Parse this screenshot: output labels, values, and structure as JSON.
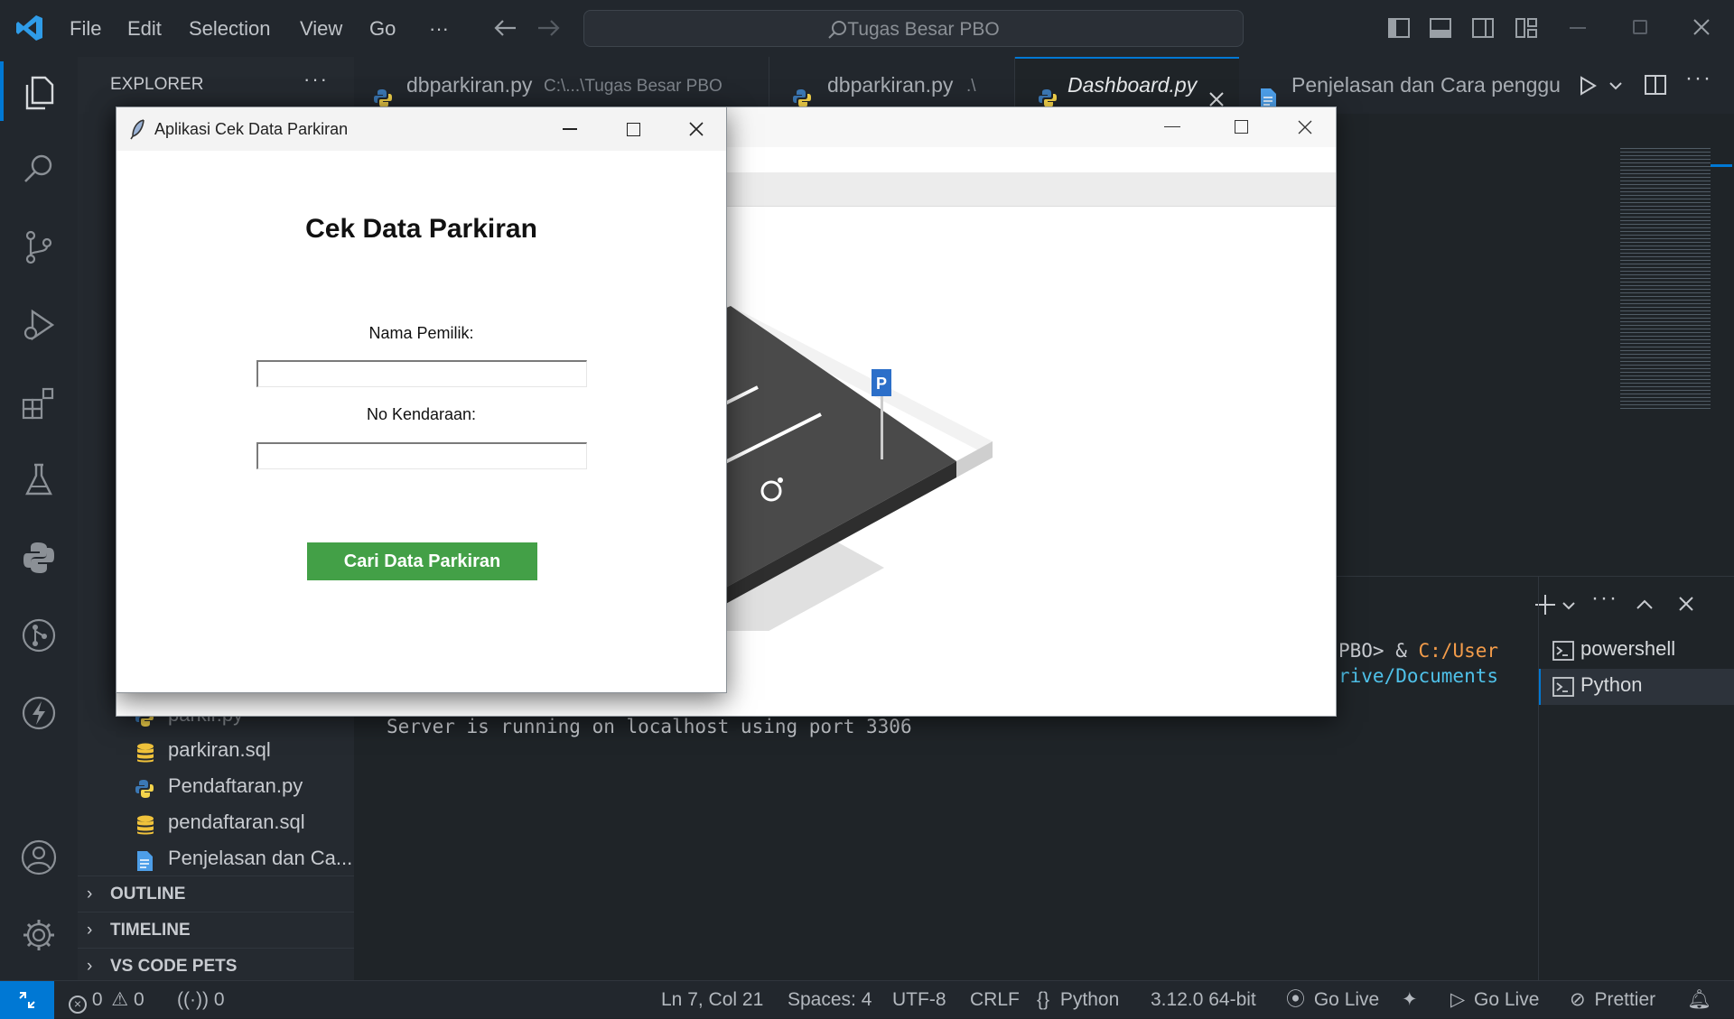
{
  "titlebar": {
    "menu": [
      "File",
      "Edit",
      "Selection",
      "View",
      "Go",
      "···"
    ],
    "search_label": "Tugas Besar PBO"
  },
  "sidebar": {
    "title": "EXPLORER",
    "files": [
      {
        "name": "parkir.py",
        "icon": "python-icon"
      },
      {
        "name": "parkiran.sql",
        "icon": "database-icon"
      },
      {
        "name": "Pendaftaran.py",
        "icon": "python-icon"
      },
      {
        "name": "pendaftaran.sql",
        "icon": "database-icon"
      },
      {
        "name": "Penjelasan dan Ca...",
        "icon": "document-icon"
      }
    ],
    "sections": [
      "OUTLINE",
      "TIMELINE",
      "VS CODE PETS"
    ]
  },
  "tabs": [
    {
      "label": "dbparkiran.py",
      "path": "C:\\...\\Tugas Besar PBO"
    },
    {
      "label": "dbparkiran.py",
      "path": ".\\"
    },
    {
      "label": "Dashboard.py",
      "path": ""
    },
    {
      "label": "Penjelasan dan Cara penggu",
      "path": ""
    }
  ],
  "terminal": {
    "line1_a": "PBO> & ",
    "line1_b": "C:/User",
    "line2": "rive/Documents",
    "output": "Server is running on localhost using port 3306",
    "sessions": [
      "powershell",
      "Python"
    ]
  },
  "statusbar": {
    "errors": "0",
    "warnings": "0",
    "ports": "0",
    "position": "Ln 7, Col 21",
    "spaces": "Spaces: 4",
    "encoding": "UTF-8",
    "eol": "CRLF",
    "language": "Python",
    "interpreter": "3.12.0 64-bit",
    "golive1": "Go Live",
    "golive2": "Go Live",
    "prettier": "Prettier"
  },
  "cek_window": {
    "title": "Aplikasi Cek Data Parkiran",
    "heading": "Cek Data Parkiran",
    "label_owner": "Nama Pemilik:",
    "label_plate": "No Kendaraan:",
    "owner_value": "",
    "plate_value": "",
    "button": "Cari Data Parkiran",
    "button_color": "#43a047"
  },
  "colors": {
    "accent": "#0078d4",
    "python_blue": "#3b78b5",
    "python_yellow": "#f5d44b"
  }
}
